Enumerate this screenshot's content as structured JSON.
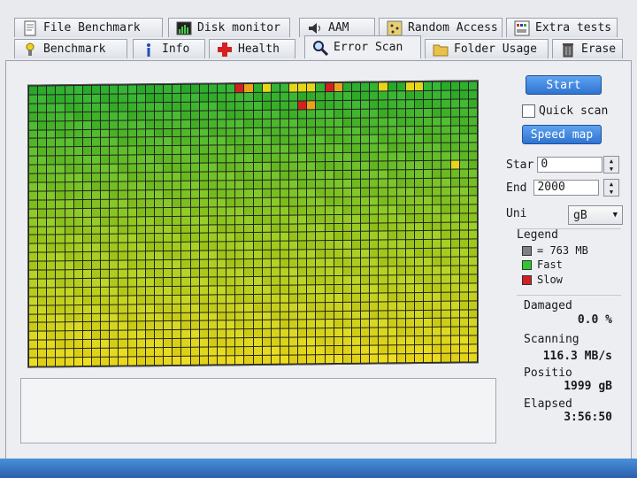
{
  "tabs_back": [
    {
      "label": "File Benchmark",
      "icon": "file-benchmark-icon"
    },
    {
      "label": "Disk monitor",
      "icon": "disk-monitor-icon"
    },
    {
      "label": "AAM",
      "icon": "speaker-icon"
    },
    {
      "label": "Random Access",
      "icon": "random-access-icon"
    },
    {
      "label": "Extra tests",
      "icon": "extra-tests-icon"
    }
  ],
  "tabs_front": [
    {
      "label": "Benchmark",
      "icon": "benchmark-icon"
    },
    {
      "label": "Info",
      "icon": "info-icon"
    },
    {
      "label": "Health",
      "icon": "health-icon"
    },
    {
      "label": "Error Scan",
      "icon": "magnifier-icon",
      "active": true
    },
    {
      "label": "Folder Usage",
      "icon": "folder-icon"
    },
    {
      "label": "Erase",
      "icon": "trash-icon"
    }
  ],
  "controls": {
    "start_button": "Start",
    "quick_scan_label": "Quick scan",
    "speed_map_button": "Speed map",
    "start_label": "Star",
    "start_value": "0",
    "end_label": "End",
    "end_value": "2000",
    "unit_label": "Uni",
    "unit_value": "gB"
  },
  "legend": {
    "title": "Legend",
    "items": [
      {
        "label": "= 763 MB",
        "color": "#808080"
      },
      {
        "label": "Fast",
        "color": "#2ec82e"
      },
      {
        "label": "Slow",
        "color": "#d42020"
      }
    ]
  },
  "stats": {
    "damaged_label": "Damaged",
    "damaged_value": "0.0 %",
    "scanning_label": "Scanning",
    "scanning_value": "116.3 MB/s",
    "position_label": "Positio",
    "position_value": "1999 gB",
    "elapsed_label": "Elapsed",
    "elapsed_value": "3:56:50"
  },
  "colors": {
    "fast": "#2fb02f",
    "mid": "#9cc91e",
    "slow_yellow": "#e6d61a",
    "orange": "#e9a21b",
    "red": "#d42020",
    "button_blue": "#3a82e0"
  },
  "scan_map": {
    "columns": 50,
    "rows": 32
  }
}
